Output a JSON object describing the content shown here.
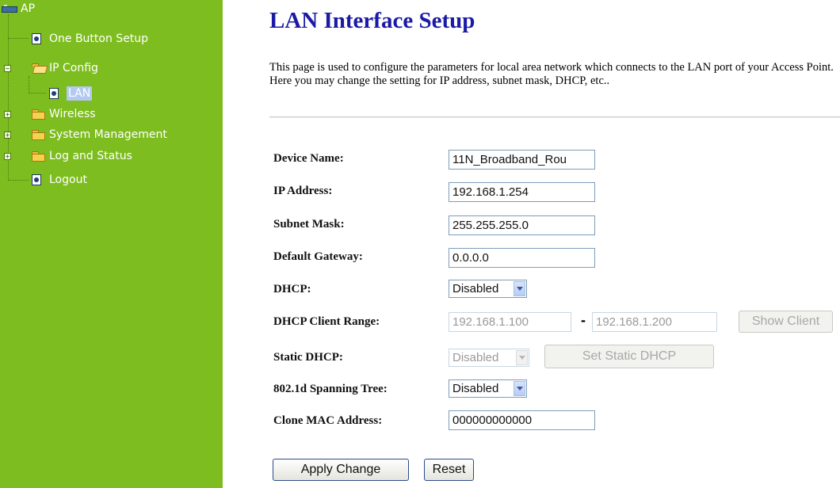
{
  "sidebar": {
    "root_label": "AP",
    "items": {
      "one_button_setup": "One Button Setup",
      "ip_config": "IP Config",
      "lan": "LAN",
      "wireless": "Wireless",
      "system_management": "System Management",
      "log_and_status": "Log and Status",
      "logout": "Logout"
    },
    "expanders": {
      "ip_config": "−",
      "wireless": "+",
      "system_management": "+",
      "log_and_status": "+"
    }
  },
  "main": {
    "title": "LAN Interface Setup",
    "description": "This page is used to configure the parameters for local area network which connects to the LAN port of your Access Point. Here you may change the setting for IP address, subnet mask, DHCP, etc..",
    "fields": {
      "device_name": {
        "label": "Device Name:",
        "value": "11N_Broadband_Rou"
      },
      "ip_address": {
        "label": "IP Address:",
        "value": "192.168.1.254"
      },
      "subnet_mask": {
        "label": "Subnet Mask:",
        "value": "255.255.255.0"
      },
      "default_gateway": {
        "label": "Default Gateway:",
        "value": "0.0.0.0"
      },
      "dhcp": {
        "label": "DHCP:",
        "value": "Disabled"
      },
      "dhcp_client_range": {
        "label": "DHCP Client Range:",
        "start": "192.168.1.100",
        "separator": "-",
        "end": "192.168.1.200",
        "button": "Show Client"
      },
      "static_dhcp": {
        "label": "Static DHCP:",
        "value": "Disabled",
        "button": "Set Static DHCP"
      },
      "spanning_tree": {
        "label": "802.1d Spanning Tree:",
        "value": "Disabled"
      },
      "clone_mac": {
        "label": "Clone MAC Address:",
        "value": "000000000000"
      }
    },
    "buttons": {
      "apply": "Apply Change",
      "reset": "Reset"
    }
  },
  "colors": {
    "sidebar_bg": "#7dbd1f",
    "title": "#1a1aa6",
    "selected": "#b3c9f2"
  }
}
